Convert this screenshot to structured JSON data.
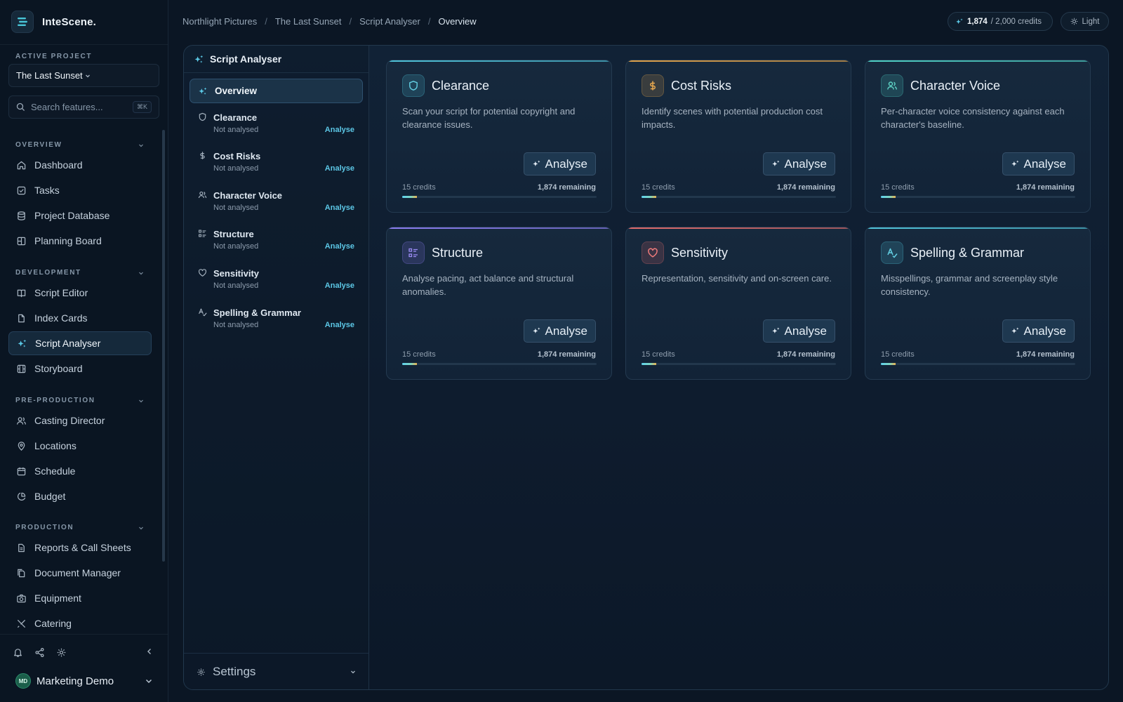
{
  "app": {
    "name": "InteScene."
  },
  "sidebar": {
    "active_project_label": "ACTIVE PROJECT",
    "project": "The Last Sunset",
    "search": {
      "placeholder": "Search features...",
      "shortcut": "⌘K"
    },
    "sections": [
      {
        "label": "OVERVIEW",
        "items": [
          {
            "label": "Dashboard",
            "icon": "home-icon"
          },
          {
            "label": "Tasks",
            "icon": "checkbox-icon"
          },
          {
            "label": "Project Database",
            "icon": "database-icon"
          },
          {
            "label": "Planning Board",
            "icon": "board-icon"
          }
        ]
      },
      {
        "label": "DEVELOPMENT",
        "items": [
          {
            "label": "Script Editor",
            "icon": "book-icon"
          },
          {
            "label": "Index Cards",
            "icon": "file-icon"
          },
          {
            "label": "Script Analyser",
            "icon": "sparkles-icon",
            "active": true
          },
          {
            "label": "Storyboard",
            "icon": "film-icon"
          }
        ]
      },
      {
        "label": "PRE-PRODUCTION",
        "items": [
          {
            "label": "Casting Director",
            "icon": "users-icon"
          },
          {
            "label": "Locations",
            "icon": "map-pin-icon"
          },
          {
            "label": "Schedule",
            "icon": "calendar-icon"
          },
          {
            "label": "Budget",
            "icon": "pie-chart-icon"
          }
        ]
      },
      {
        "label": "PRODUCTION",
        "items": [
          {
            "label": "Reports & Call Sheets",
            "icon": "report-icon"
          },
          {
            "label": "Document Manager",
            "icon": "documents-icon"
          },
          {
            "label": "Equipment",
            "icon": "camera-icon"
          },
          {
            "label": "Catering",
            "icon": "utensils-icon"
          }
        ]
      }
    ],
    "user": {
      "initials": "MD",
      "name": "Marketing Demo"
    }
  },
  "breadcrumb": [
    "Northlight Pictures",
    "The Last Sunset",
    "Script Analyser",
    "Overview"
  ],
  "credits": {
    "used": "1,874",
    "total_label": "/ 2,000 credits"
  },
  "theme_toggle": "Light",
  "analyser": {
    "title": "Script Analyser",
    "overview_label": "Overview",
    "settings_label": "Settings",
    "features": [
      {
        "name": "Clearance",
        "status": "Not analysed",
        "action": "Analyse",
        "icon": "shield-icon",
        "description": "Scan your script for potential copyright and clearance issues.",
        "cost": "15 credits",
        "remaining": "1,874 remaining",
        "button": "Analyse",
        "accent": "#4fc3d9",
        "credit_fraction": 0.075
      },
      {
        "name": "Cost Risks",
        "status": "Not analysed",
        "action": "Analyse",
        "icon": "dollar-icon",
        "description": "Identify scenes with potential production cost impacts.",
        "cost": "15 credits",
        "remaining": "1,874 remaining",
        "button": "Analyse",
        "accent": "#e0a24a",
        "credit_fraction": 0.075
      },
      {
        "name": "Character Voice",
        "status": "Not analysed",
        "action": "Analyse",
        "icon": "users-icon",
        "description": "Per-character voice consistency against each character's baseline.",
        "cost": "15 credits",
        "remaining": "1,874 remaining",
        "button": "Analyse",
        "accent": "#4fd1c5",
        "credit_fraction": 0.075
      },
      {
        "name": "Structure",
        "status": "Not analysed",
        "action": "Analyse",
        "icon": "list-icon",
        "description": "Analyse pacing, act balance and structural anomalies.",
        "cost": "15 credits",
        "remaining": "1,874 remaining",
        "button": "Analyse",
        "accent": "#8b7cf0",
        "credit_fraction": 0.075
      },
      {
        "name": "Sensitivity",
        "status": "Not analysed",
        "action": "Analyse",
        "icon": "heart-icon",
        "description": "Representation, sensitivity and on-screen care.",
        "cost": "15 credits",
        "remaining": "1,874 remaining",
        "button": "Analyse",
        "accent": "#e06a6a",
        "credit_fraction": 0.075
      },
      {
        "name": "Spelling & Grammar",
        "status": "Not analysed",
        "action": "Analyse",
        "icon": "spellcheck-icon",
        "description": "Misspellings, grammar and screenplay style consistency.",
        "cost": "15 credits",
        "remaining": "1,874 remaining",
        "button": "Analyse",
        "accent": "#4fc3d9",
        "credit_fraction": 0.075
      }
    ]
  }
}
